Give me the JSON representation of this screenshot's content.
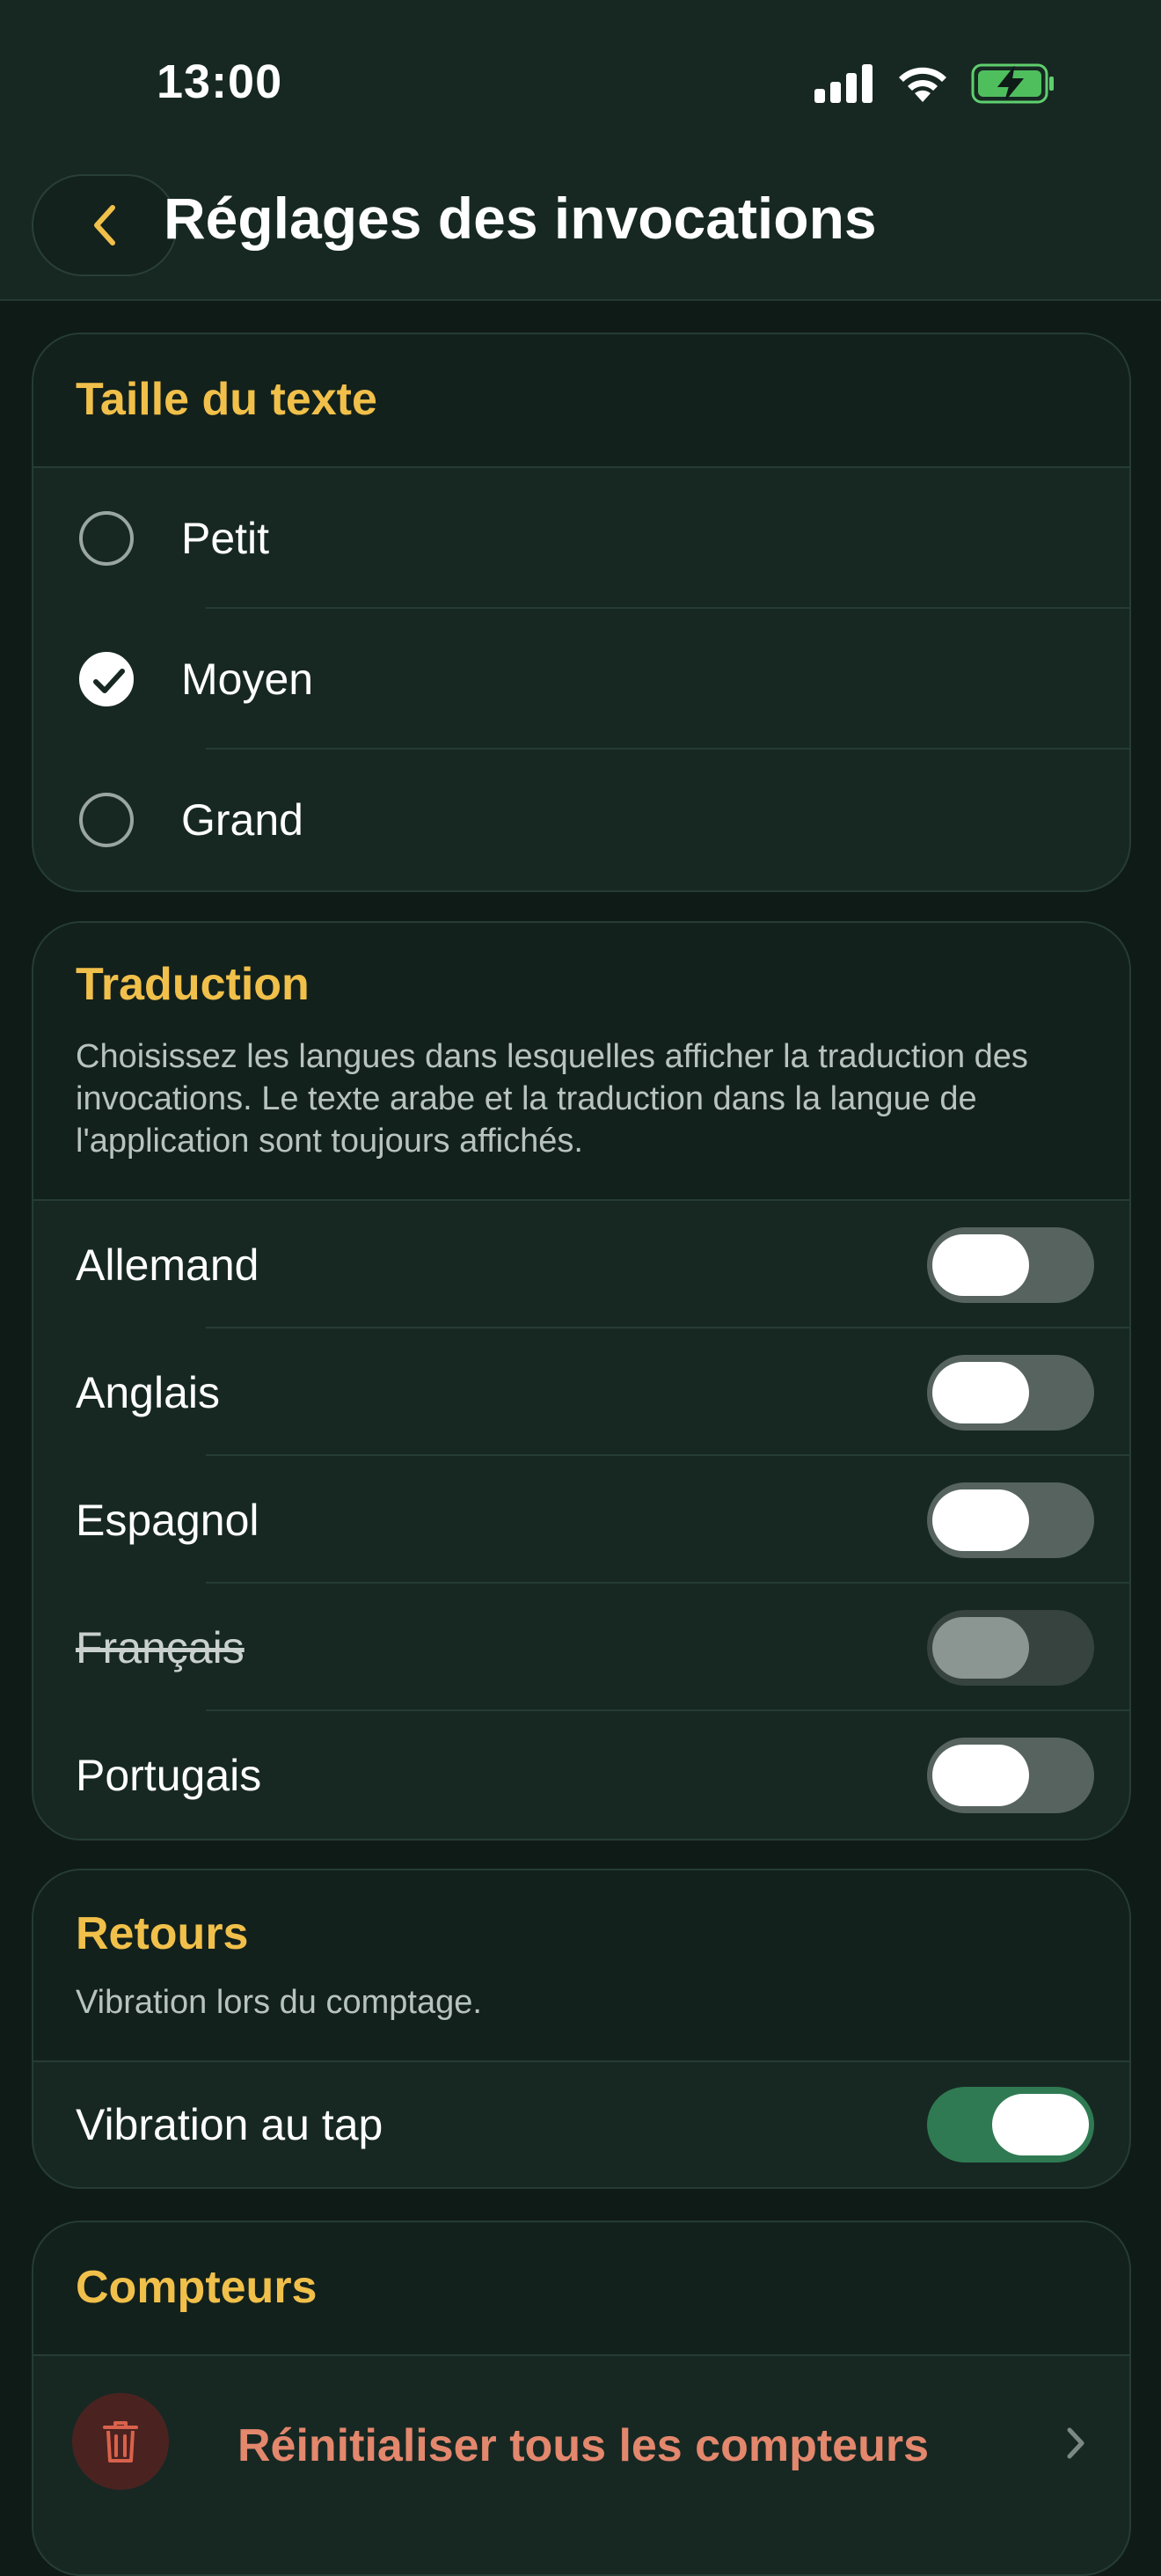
{
  "status_bar": {
    "time": "13:00",
    "icons": [
      "cellular-signal-icon",
      "wifi-icon",
      "battery-charging-icon"
    ]
  },
  "header": {
    "back_icon": "chevron-left-icon",
    "title": "Réglages des invocations"
  },
  "text_size": {
    "title": "Taille du texte",
    "options": [
      {
        "label": "Petit",
        "selected": false
      },
      {
        "label": "Moyen",
        "selected": true
      },
      {
        "label": "Grand",
        "selected": false
      }
    ]
  },
  "translation": {
    "title": "Traduction",
    "description": "Choisissez les langues dans lesquelles afficher la traduction des invocations. Le texte arabe et la traduction dans la langue de l'application sont toujours affichés.",
    "languages": [
      {
        "label": "Allemand",
        "enabled": false,
        "disabled": false
      },
      {
        "label": "Anglais",
        "enabled": false,
        "disabled": false
      },
      {
        "label": "Espagnol",
        "enabled": false,
        "disabled": false
      },
      {
        "label": "Français",
        "enabled": false,
        "disabled": true
      },
      {
        "label": "Portugais",
        "enabled": false,
        "disabled": false
      }
    ]
  },
  "feedback": {
    "title": "Retours",
    "description": "Vibration lors du comptage.",
    "toggle_label": "Vibration au tap",
    "toggle_on": true
  },
  "counters": {
    "title": "Compteurs",
    "reset_label": "Réinitialiser tous les compteurs",
    "reset_icon": "trash-icon",
    "chevron_icon": "chevron-right-icon"
  },
  "colors": {
    "accent": "#f1c04a",
    "background": "#0f1b17",
    "card": "#172823",
    "toggle_on": "#2f7a52",
    "destructive": "#e3876d"
  }
}
